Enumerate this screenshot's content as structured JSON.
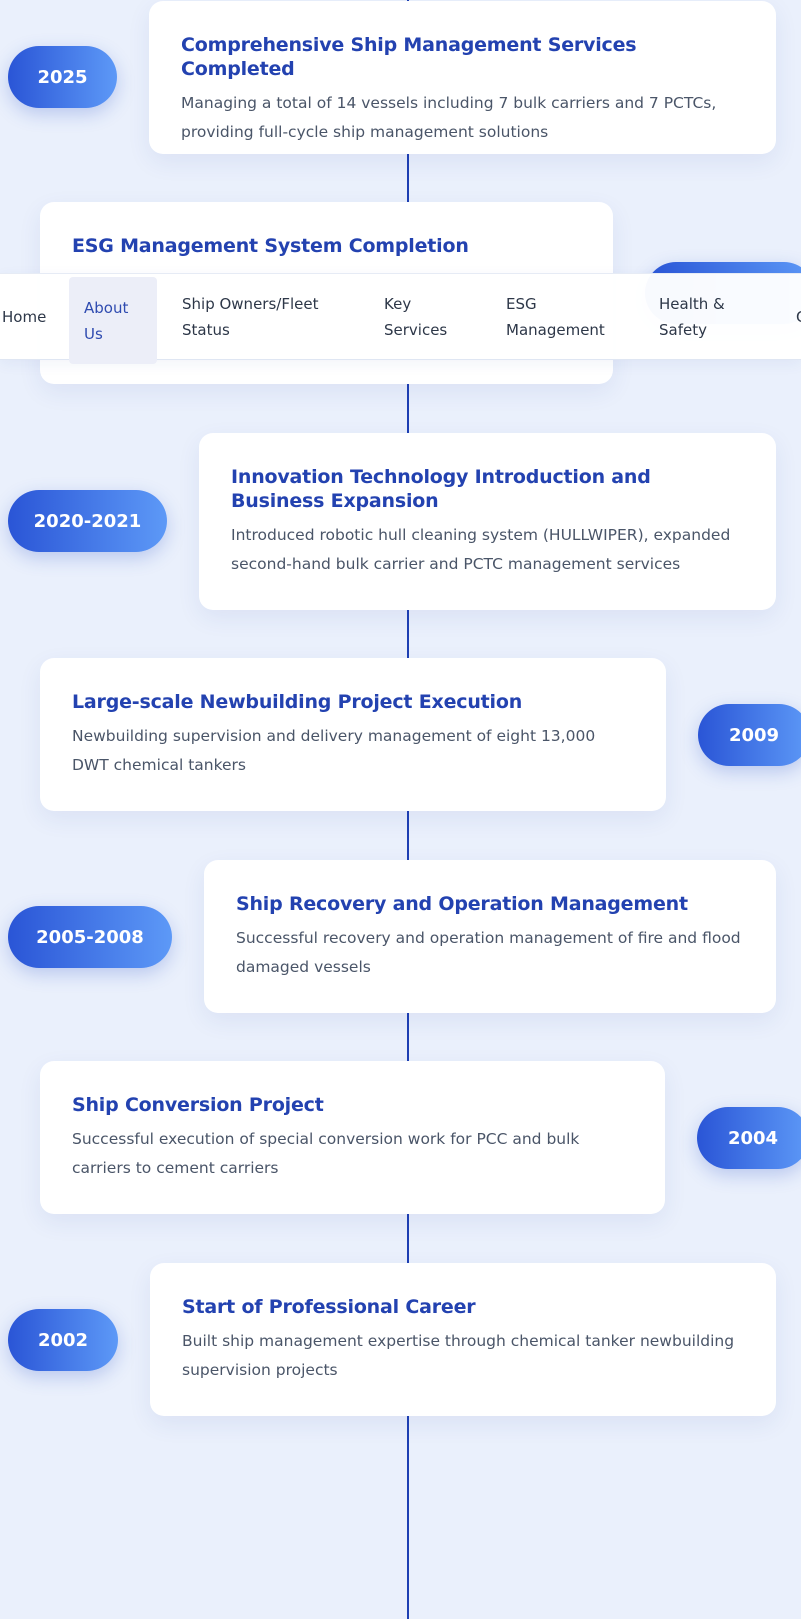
{
  "nav": {
    "items": [
      {
        "label": "Home"
      },
      {
        "label": "About\nUs"
      },
      {
        "label": "Ship Owners/Fleet\nStatus"
      },
      {
        "label": "Key\nServices"
      },
      {
        "label": "ESG\nManagement"
      },
      {
        "label": "Health &\nSafety"
      },
      {
        "label": "C"
      }
    ],
    "active": "About Us"
  },
  "timeline": {
    "events": [
      {
        "year": "2025",
        "title": "Comprehensive Ship Management Services Completed",
        "description": "Managing a total of 14 vessels including 7 bulk carriers and 7 PCTCs, providing full-cycle ship management solutions"
      },
      {
        "year": "",
        "title": "ESG Management System Completion",
        "description": ""
      },
      {
        "year": "2020-2021",
        "title": "Innovation Technology Introduction and Business Expansion",
        "description": "Introduced robotic hull cleaning system (HULLWIPER), expanded second-hand bulk carrier and PCTC management services"
      },
      {
        "year": "2009",
        "title": "Large-scale Newbuilding Project Execution",
        "description": "Newbuilding supervision and delivery management of eight 13,000 DWT chemical tankers"
      },
      {
        "year": "2005-2008",
        "title": "Ship Recovery and Operation Management",
        "description": "Successful recovery and operation management of fire and flood damaged vessels"
      },
      {
        "year": "2004",
        "title": "Ship Conversion Project",
        "description": "Successful execution of special conversion work for PCC and bulk carriers to cement carriers"
      },
      {
        "year": "2002",
        "title": "Start of Professional Career",
        "description": "Built ship management expertise through chemical tanker newbuilding supervision projects"
      }
    ]
  },
  "colors": {
    "background": "#eaf0fc",
    "accent": "#2342b0",
    "badge_gradient_start": "#2a55d6",
    "badge_gradient_end": "#5d99f7",
    "timeline_line": "#1e3fb3"
  }
}
